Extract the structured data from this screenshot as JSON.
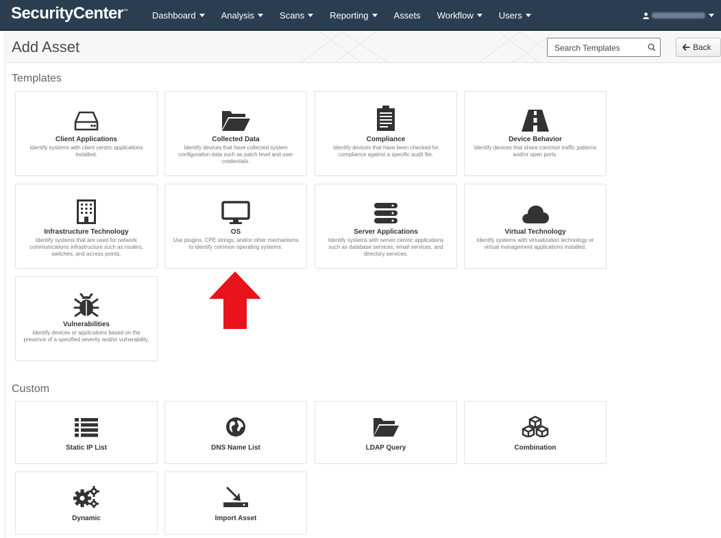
{
  "app": {
    "brand": "SecurityCenter",
    "brand_mark": "™"
  },
  "nav": [
    {
      "label": "Dashboard",
      "has_caret": true
    },
    {
      "label": "Analysis",
      "has_caret": true
    },
    {
      "label": "Scans",
      "has_caret": true
    },
    {
      "label": "Reporting",
      "has_caret": true
    },
    {
      "label": "Assets",
      "has_caret": false
    },
    {
      "label": "Workflow",
      "has_caret": true
    },
    {
      "label": "Users",
      "has_caret": true
    }
  ],
  "header": {
    "title": "Add Asset",
    "search_placeholder": "Search Templates",
    "back_label": "Back"
  },
  "sections": {
    "templates": "Templates",
    "custom": "Custom"
  },
  "templates": [
    {
      "title": "Client Applications",
      "desc": "Identify systems with client centric applications installed.",
      "icon": "hdd-icon"
    },
    {
      "title": "Collected Data",
      "desc": "Identify devices that have collected system configuration data such as patch level and user credentials.",
      "icon": "folder-open-icon"
    },
    {
      "title": "Compliance",
      "desc": "Identify devices that have been checked for compliance against a specific audit file.",
      "icon": "clipboard-icon"
    },
    {
      "title": "Device Behavior",
      "desc": "Identify devices that share common traffic patterns and/or open ports.",
      "icon": "road-icon"
    },
    {
      "title": "Infrastructure Technology",
      "desc": "Identify systems that are used for network communications infrastructure such as routers, switches, and access points.",
      "icon": "building-icon"
    },
    {
      "title": "OS",
      "desc": "Use plugins, CPE strings, and/or other mechanisms to identify common operating systems.",
      "icon": "monitor-icon"
    },
    {
      "title": "Server Applications",
      "desc": "Identify systems with server centric applications such as database services, email services, and directory services.",
      "icon": "server-icon"
    },
    {
      "title": "Virtual Technology",
      "desc": "Identify systems with virtualization technology or virtual management applications installed.",
      "icon": "cloud-icon"
    },
    {
      "title": "Vulnerabilities",
      "desc": "Identify devices or applications based on the presence of a specified severity and/or vulnerability.",
      "icon": "bug-icon"
    }
  ],
  "custom": [
    {
      "title": "Static IP List",
      "icon": "list-icon"
    },
    {
      "title": "DNS Name List",
      "icon": "globe-icon"
    },
    {
      "title": "LDAP Query",
      "icon": "folder-icon"
    },
    {
      "title": "Combination",
      "icon": "cubes-icon"
    },
    {
      "title": "Dynamic",
      "icon": "gears-icon"
    },
    {
      "title": "Import Asset",
      "icon": "import-icon"
    }
  ],
  "colors": {
    "topbar": "#2b3e51",
    "icon": "#333333",
    "arrow": "#e8131b"
  }
}
